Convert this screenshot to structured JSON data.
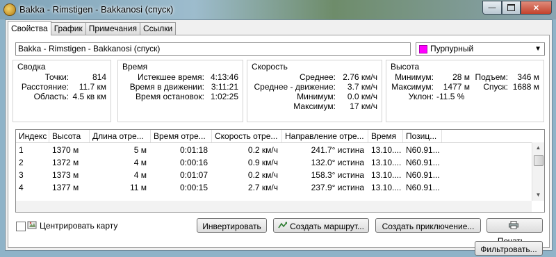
{
  "window": {
    "title": "Bakka - Rimstigen - Bakkanosi (спуск)",
    "minimize_icon": "minimize-icon",
    "maximize_icon": "maximize-icon",
    "close_icon": "close-icon"
  },
  "tabs": [
    {
      "label": "Свойства",
      "active": true
    },
    {
      "label": "График"
    },
    {
      "label": "Примечания"
    },
    {
      "label": "Ссылки"
    }
  ],
  "name_field": {
    "value": "Bakka - Rimstigen - Bakkanosi (спуск)"
  },
  "color": {
    "label": "Пурпурный",
    "swatch": "#ff00ff"
  },
  "summary": {
    "title": "Сводка",
    "points_label": "Точки:",
    "points_value": "814",
    "distance_label": "Расстояние:",
    "distance_value": "11.7 км",
    "area_label": "Область:",
    "area_value": "4.5 кв км"
  },
  "time": {
    "title": "Время",
    "elapsed_label": "Истекшее время:",
    "elapsed_value": "4:13:46",
    "moving_label": "Время в движении:",
    "moving_value": "3:11:21",
    "stopped_label": "Время остановок:",
    "stopped_value": "1:02:25"
  },
  "speed": {
    "title": "Скорость",
    "avg_label": "Среднее:",
    "avg_value": "2.76 км/ч",
    "avg_moving_label": "Среднее - движение:",
    "avg_moving_value": "3.7 км/ч",
    "min_label": "Минимум:",
    "min_value": "0.0 км/ч",
    "max_label": "Максимум:",
    "max_value": "17 км/ч"
  },
  "elevation": {
    "title": "Высота",
    "min_label": "Минимум:",
    "min_value": "28 м",
    "max_label": "Максимум:",
    "max_value": "1477 м",
    "slope_label": "Уклон:",
    "slope_value": "-11.5 %",
    "ascent_label": "Подъем:",
    "ascent_value": "346 м",
    "descent_label": "Спуск:",
    "descent_value": "1688 м"
  },
  "table": {
    "columns": [
      "Индекс",
      "Высота",
      "Длина отре...",
      "Время отре...",
      "Скорость отре...",
      "Направление отре...",
      "Время",
      "Позиц..."
    ],
    "rows": [
      [
        "1",
        "1370 м",
        "5 м",
        "0:01:18",
        "0.2 км/ч",
        "241.7° истина",
        "13.10....",
        "N60.91..."
      ],
      [
        "2",
        "1372 м",
        "4 м",
        "0:00:16",
        "0.9 км/ч",
        "132.0° истина",
        "13.10....",
        "N60.91..."
      ],
      [
        "3",
        "1373 м",
        "4 м",
        "0:01:07",
        "0.2 км/ч",
        "158.3° истина",
        "13.10....",
        "N60.91..."
      ],
      [
        "4",
        "1377 м",
        "11 м",
        "0:00:15",
        "2.7 км/ч",
        "237.9° истина",
        "13.10....",
        "N60.91..."
      ]
    ]
  },
  "controls": {
    "center_map_label": "Центрировать карту",
    "center_map_checked": false,
    "invert_label": "Инвертировать",
    "create_route_label": "Создать маршрут...",
    "create_adventure_label": "Создать приключение...",
    "print_label": "Печать...",
    "filter_label": "Фильтровать..."
  }
}
